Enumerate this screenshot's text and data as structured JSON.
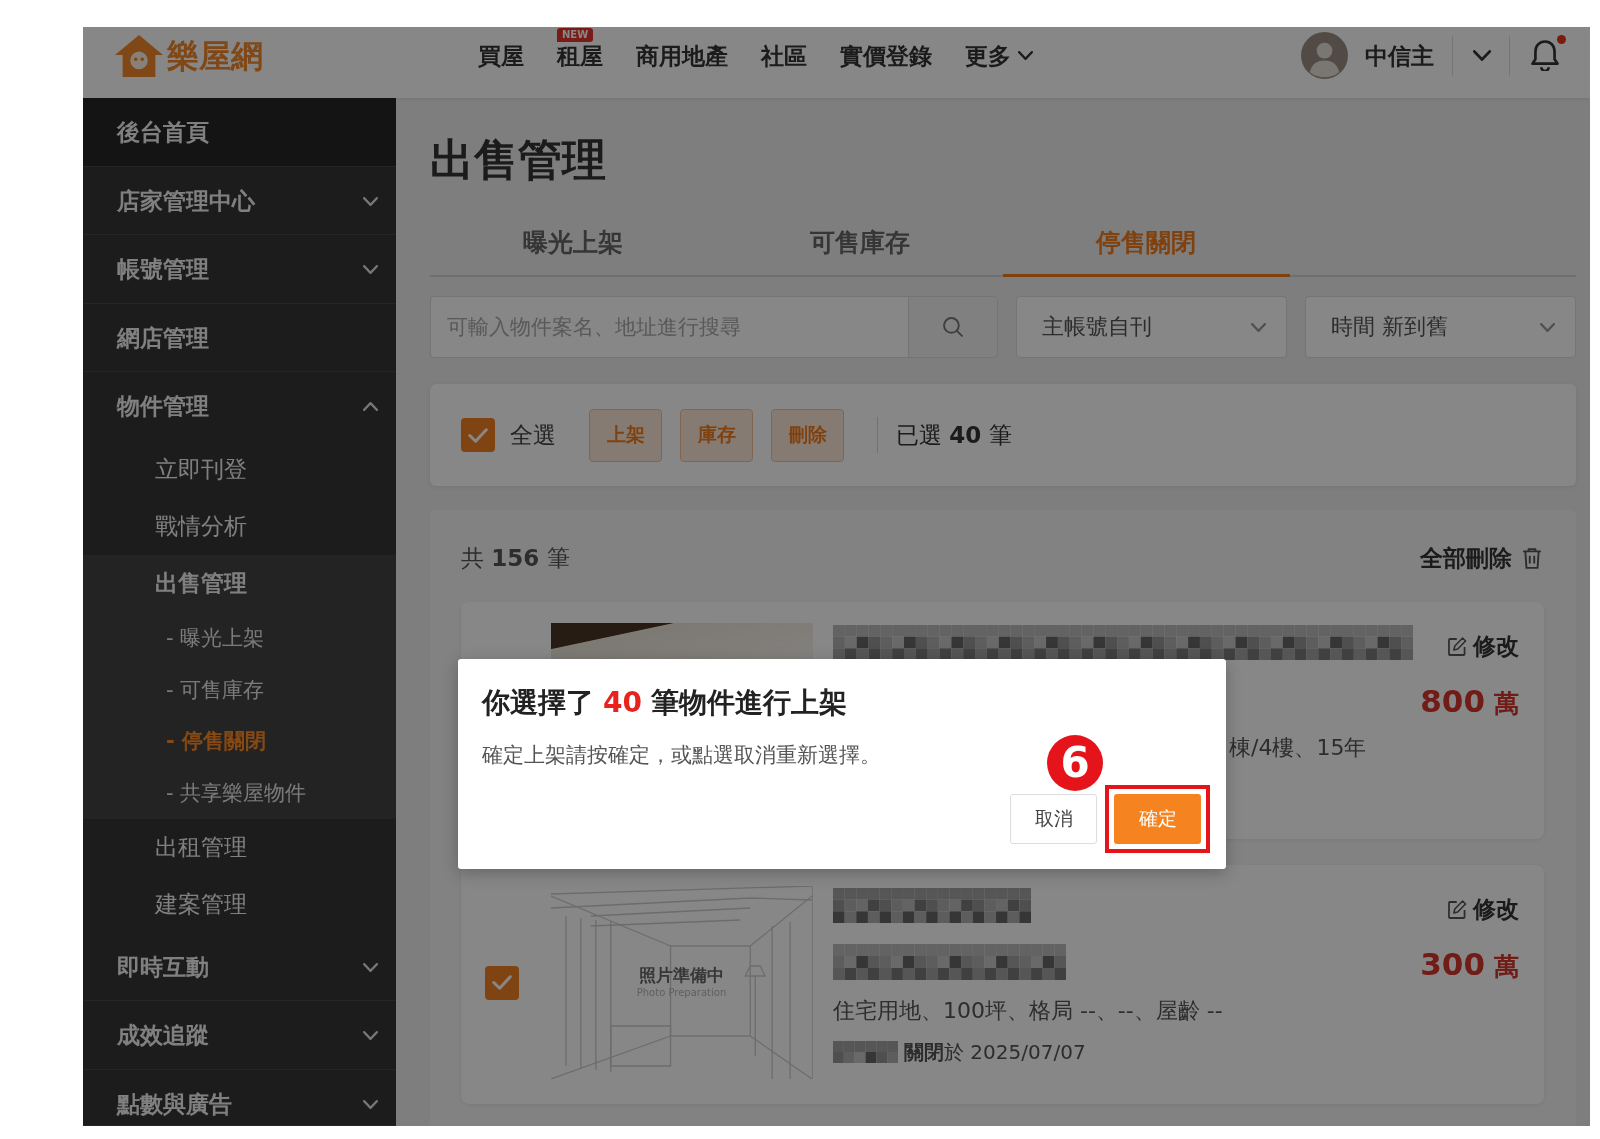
{
  "header": {
    "logo": "樂屋網",
    "nav": [
      {
        "label": "買屋",
        "dropdown": false
      },
      {
        "label": "租屋",
        "badge": "NEW",
        "dropdown": false
      },
      {
        "label": "商用地產",
        "dropdown": false
      },
      {
        "label": "社區",
        "dropdown": false
      },
      {
        "label": "實價登錄",
        "dropdown": false
      },
      {
        "label": "更多",
        "dropdown": true
      }
    ],
    "user": {
      "name": "中信主"
    },
    "notifications": {
      "unread": true
    }
  },
  "sidebar": {
    "items": [
      {
        "label": "後台首頁",
        "kind": "home",
        "selected": false
      },
      {
        "label": "店家管理中心",
        "kind": "group",
        "expanded": false,
        "selected": false
      },
      {
        "label": "帳號管理",
        "kind": "group",
        "expanded": false,
        "selected": false
      },
      {
        "label": "網店管理",
        "kind": "link",
        "selected": false
      },
      {
        "label": "物件管理",
        "kind": "group",
        "expanded": true,
        "selected": false,
        "children": [
          {
            "label": "立即刊登",
            "selected": false
          },
          {
            "label": "戰情分析",
            "selected": false
          },
          {
            "label": "出售管理",
            "expanded": true,
            "selected": false,
            "children": [
              {
                "label": "- 曝光上架",
                "selected": false
              },
              {
                "label": "- 可售庫存",
                "selected": false
              },
              {
                "label": "- 停售關閉",
                "selected": true
              },
              {
                "label": "- 共享樂屋物件",
                "selected": false
              }
            ]
          },
          {
            "label": "出租管理",
            "selected": false
          },
          {
            "label": "建案管理",
            "selected": false
          }
        ]
      },
      {
        "label": "即時互動",
        "kind": "group",
        "expanded": false,
        "selected": false
      },
      {
        "label": "成效追蹤",
        "kind": "group",
        "expanded": false,
        "selected": false
      },
      {
        "label": "點數與廣告",
        "kind": "group",
        "expanded": false,
        "selected": false
      }
    ]
  },
  "page": {
    "title": "出售管理"
  },
  "tabs": [
    {
      "label": "曝光上架",
      "selected": false
    },
    {
      "label": "可售庫存",
      "selected": false
    },
    {
      "label": "停售關閉",
      "selected": true
    }
  ],
  "filters": {
    "search": {
      "placeholder": "可輸入物件案名、地址進行搜尋"
    },
    "selects": [
      {
        "value": "主帳號自刊"
      },
      {
        "value": "時間 新到舊"
      }
    ]
  },
  "bulk_bar": {
    "select_all": {
      "label": "全選",
      "checked": true
    },
    "actions": [
      {
        "label": "上架"
      },
      {
        "label": "庫存"
      },
      {
        "label": "刪除"
      }
    ],
    "selection": "已選 **40** 筆"
  },
  "listings": {
    "total": "共 **156** 筆",
    "delete_all": "全部刪除",
    "items": [
      {
        "photo": {
          "kind": "photo"
        },
        "edit": "修改",
        "price": "800",
        "price_unit": "萬",
        "specs": "棟/4樓、15年"
      },
      {
        "checked": true,
        "photo": {
          "kind": "placeholder",
          "caption": "照片準備中",
          "subcaption": "Photo Preparation"
        },
        "edit": "修改",
        "price": "300",
        "price_unit": "萬",
        "specs": "住宅用地、100坪、格局 --、--、屋齡 --",
        "closed_note": "**關閉**於 2025/07/07"
      }
    ]
  },
  "dialog": {
    "title": "你選擇了",
    "count": "40",
    "title_end": "筆物件進行上架",
    "message": "確定上架請按確定，或點選取消重新選擇。",
    "buttons": [
      {
        "label": "取消",
        "kind": "secondary",
        "highlighted": false
      },
      {
        "label": "確定",
        "kind": "primary",
        "highlighted": true,
        "step": "6"
      }
    ]
  }
}
